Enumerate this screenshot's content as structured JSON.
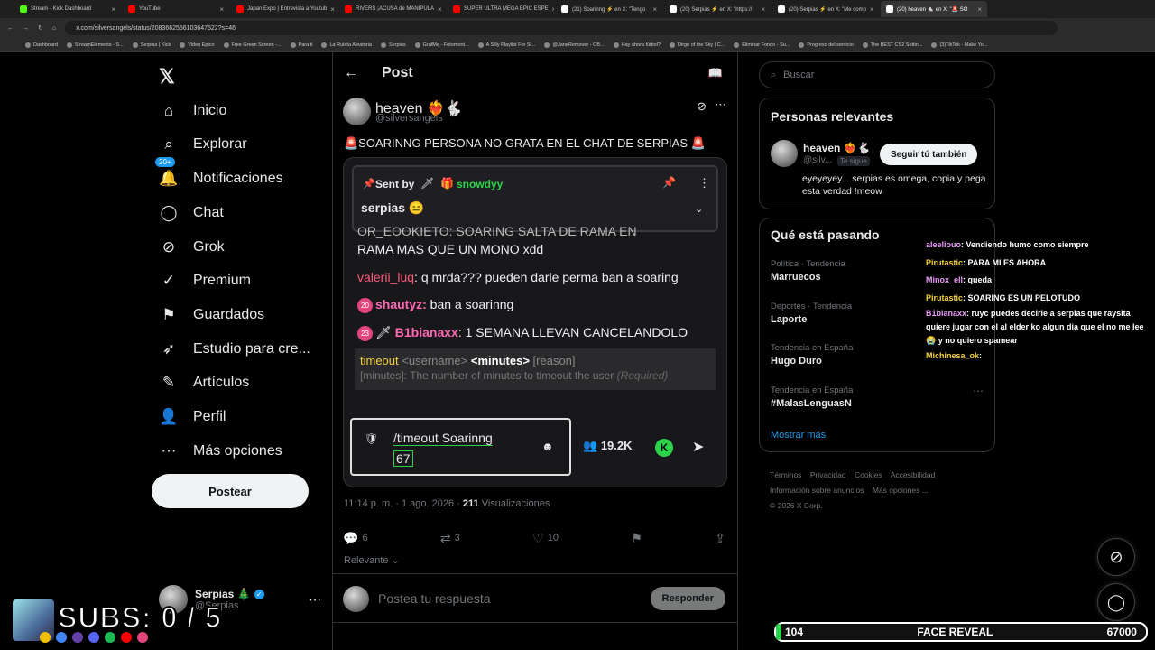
{
  "browser": {
    "tabs": [
      {
        "title": "Stream - Kick Dashboard",
        "color": "#53fc18",
        "active": false
      },
      {
        "title": "YouTube",
        "color": "#ff0000",
        "active": false
      },
      {
        "title": "Japan Expo | Entrevista a Youtub",
        "color": "#ff0000",
        "active": false
      },
      {
        "title": "RIVERS ¡ACUSA de MANIPULA",
        "color": "#ff0000",
        "active": false
      },
      {
        "title": "SUPER ULTRA MEGA EPIC ESPE",
        "color": "#ff0000",
        "active": false
      },
      {
        "title": "(21) Soarinng ⚡ en X: \"Tengo",
        "color": "#ffffff",
        "active": false
      },
      {
        "title": "(20) Serpias ⚡ en X: \"https://",
        "color": "#ffffff",
        "active": false
      },
      {
        "title": "(20) Serpias ⚡ en X: \"Me comp",
        "color": "#ffffff",
        "active": false
      },
      {
        "title": "(20) heaven 🐁 en X: \"🚨 SO",
        "color": "#ffffff",
        "active": true
      }
    ],
    "url": "x.com/silversangels/status/2083662556103647522?s=46",
    "bookmarks": [
      "Dashboard",
      "StreamElements - S...",
      "Serpias | Kick",
      "Video Epico",
      "Free Green Screen -...",
      "Para ti",
      "La Ruleta Aleatoria",
      "Serpias",
      "GrafMe - Fotomont...",
      "A Silly Playlist For Si...",
      "@JaneRemover - OB...",
      "Hay ahora fútbol?",
      "Dirge of the Sky | C...",
      "Eliminar Fondo - Su...",
      "Progreso del servicio",
      "The BEST CS2 Settin...",
      "(3)TikTok - Make Yo..."
    ]
  },
  "nav": {
    "items": [
      {
        "label": "Inicio",
        "icon": "home-icon",
        "glyph": "⌂"
      },
      {
        "label": "Explorar",
        "icon": "search-icon",
        "glyph": "⌕"
      },
      {
        "label": "Notificaciones",
        "icon": "bell-icon",
        "glyph": "🔔"
      },
      {
        "label": "Chat",
        "icon": "chat-icon",
        "glyph": "◯"
      },
      {
        "label": "Grok",
        "icon": "grok-icon",
        "glyph": "⊘"
      },
      {
        "label": "Premium",
        "icon": "premium-icon",
        "glyph": "✓"
      },
      {
        "label": "Guardados",
        "icon": "bookmark-icon",
        "glyph": "⚑"
      },
      {
        "label": "Estudio para cre...",
        "icon": "rocket-icon",
        "glyph": "➶"
      },
      {
        "label": "Artículos",
        "icon": "article-icon",
        "glyph": "✎"
      },
      {
        "label": "Perfil",
        "icon": "person-icon",
        "glyph": "👤"
      },
      {
        "label": "Más opciones",
        "icon": "more-icon",
        "glyph": "⋯"
      }
    ],
    "notification_badge": "20+",
    "post_button": "Postear",
    "account": {
      "name": "Serpias 🎄",
      "handle": "@Serpias"
    }
  },
  "post": {
    "header_title": "Post",
    "author_name": "heaven ❤️‍🔥🐇",
    "author_handle": "@silversangels",
    "text": "🚨SOARINNG PERSONA NO GRATA EN EL CHAT DE SERPIAS 🚨",
    "timestamp": "11:14 p. m. · 1 ago. 2026 · ",
    "views_count": "211",
    "views_label": "Visualizaciones",
    "replies": "6",
    "reposts": "3",
    "likes": "10",
    "sort_label": "Relevante",
    "reply_placeholder": "Postea tu respuesta",
    "reply_button": "Responder"
  },
  "media": {
    "pinned_sent_by": "Sent by",
    "pinned_user": "snowdyy",
    "pinned_message": "serpias 😑",
    "partial_line_top": "OR_EOOKIETO: SOARING SALTA DE RAMA EN",
    "partial_line_2": "RAMA MAS QUE UN MONO xdd",
    "chat": [
      {
        "badge": "",
        "user": "valerii_luq",
        "message": ": q mrda??? pueden darle perma ban a soaring"
      },
      {
        "badge": "20",
        "user": "shautyz:",
        "message": " ban a soarinng"
      },
      {
        "badge": "23",
        "user": "B1bianaxx",
        "message": ": 1 SEMANA LLEVAN CANCELANDOLO"
      }
    ],
    "cmd_name": "timeout",
    "cmd_args": "<username>",
    "cmd_required": "<minutes>",
    "cmd_optional": "[reason]",
    "cmd_desc": "[minutes]: The number of minutes to timeout the user",
    "cmd_req_note": "(Required)",
    "input_value_line1": "/timeout Soarinng",
    "input_value_line2": "67",
    "viewer_count": "19.2K"
  },
  "sidebar": {
    "search_placeholder": "Buscar",
    "relevant_title": "Personas relevantes",
    "relevant_user": {
      "name": "heaven ❤️‍🔥🐇",
      "handle": "@silv...",
      "follows_you": "Te sigue",
      "follow_label": "Seguir tú también",
      "bio": "eyeyeyey... serpias es omega, copia y pega esta verdad !meow"
    },
    "trends_title": "Qué está pasando",
    "trends": [
      {
        "category": "Política · Tendencia",
        "name": "Marruecos"
      },
      {
        "category": "Deportes · Tendencia",
        "name": "Laporte"
      },
      {
        "category": "Tendencia en España",
        "name": "Hugo Duro"
      },
      {
        "category": "Tendencia en España",
        "name": "#MalasLenguasN"
      }
    ],
    "show_more": "Mostrar más",
    "footer": [
      "Términos",
      "Privacidad",
      "Cookies",
      "Accesibilidad",
      "Información sobre anuncios",
      "Más opciones ...",
      "© 2026 X Corp."
    ]
  },
  "overlay": {
    "chat": [
      {
        "user": "aleeliouo",
        "message": ": Vendiendo humo como siempre",
        "user_color": "#e79bf8"
      },
      {
        "user": "Pirutastic",
        "message": ": PARA MI ES AHORA",
        "user_color": "#f3d13a"
      },
      {
        "user": "Minox_ell",
        "message": ": queda",
        "user_color": "#e79bf8"
      },
      {
        "user": "Pirutastic",
        "message": ": SOARING ES UN PELOTUDO",
        "user_color": "#f3d13a"
      },
      {
        "user": "B1bianaxx",
        "message": ": ruyc puedes decirle a serpias que raysita quiere jugar con el al elder ko algun dia que el no me lee 😭 y no quiero spamear",
        "user_color": "#e79bf8"
      },
      {
        "user": "Michinesa_ok",
        "message": ":",
        "user_color": "#f3d13a"
      }
    ],
    "subs_text": "SUBS: 0 / 5",
    "goal_current": "104",
    "goal_label": "FACE REVEAL",
    "goal_target": "67000",
    "goal_progress": 0.0016
  }
}
